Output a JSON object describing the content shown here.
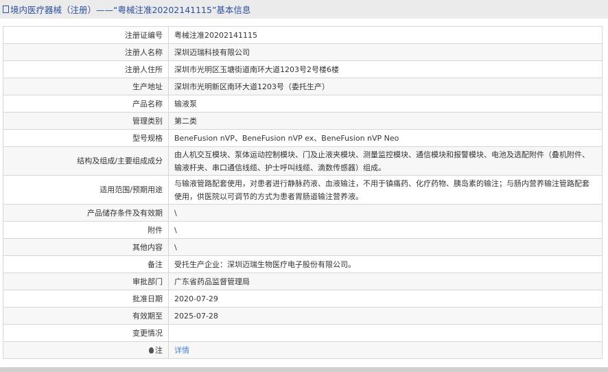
{
  "title": "境内医疗器械（注册）——“粤械注准20202141115”基本信息",
  "rows": [
    {
      "label": "注册证编号",
      "value": "粤械注准20202141115"
    },
    {
      "label": "注册人名称",
      "value": "深圳迈瑞科技有限公司"
    },
    {
      "label": "注册人住所",
      "value": "深圳市光明区玉塘街道南环大道1203号2号楼6楼"
    },
    {
      "label": "生产地址",
      "value": "深圳市光明新区南环大道1203号（委托生产）"
    },
    {
      "label": "产品名称",
      "value": "输液泵"
    },
    {
      "label": "管理类别",
      "value": "第二类"
    },
    {
      "label": "型号规格",
      "value": "BeneFusion nVP、BeneFusion nVP ex、BeneFusion nVP Neo"
    },
    {
      "label": "结构及组成/主要组成成分",
      "value": "由人机交互模块、泵体运动控制模块、门及止液夹模块、测量监控模块、通信模块和报警模块、电池及选配附件（叠机附件、输液杆夹、串口通信线缆、护士呼叫线缆、滴数传感器）组成。"
    },
    {
      "label": "适用范围/预期用途",
      "value": "与输液管路配套使用，对患者进行静脉药液、血液输注，不用于镇痛药、化疗药物、胰岛素的输注；与肠内营养输注管路配套使用，供医院以可调节的方式为患者胃肠道输注营养液。"
    },
    {
      "label": "产品储存条件及有效期",
      "value": "\\"
    },
    {
      "label": "附件",
      "value": "\\"
    },
    {
      "label": "其他内容",
      "value": "\\"
    },
    {
      "label": "备注",
      "value": "受托生产企业：深圳迈瑞生物医疗电子股份有限公司。"
    },
    {
      "label": "审批部门",
      "value": "广东省药品监督管理局"
    },
    {
      "label": "批准日期",
      "value": "2020-07-29"
    },
    {
      "label": "有效期至",
      "value": "2025-07-28"
    },
    {
      "label": "变更情况",
      "value": ""
    }
  ],
  "note": {
    "label": "注",
    "link": "详情"
  }
}
